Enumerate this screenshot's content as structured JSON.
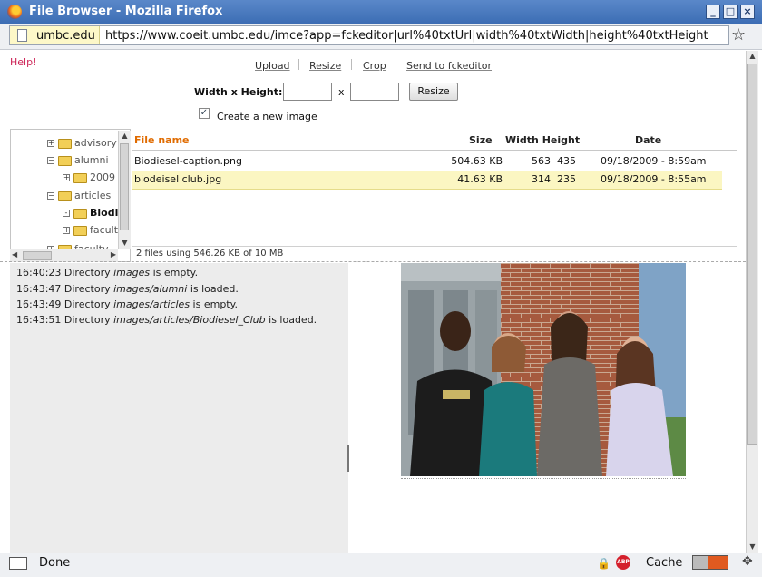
{
  "window": {
    "title": "File Browser - Mozilla Firefox"
  },
  "urlbar": {
    "site": "umbc.edu",
    "url": "https://www.coeit.umbc.edu/imce?app=fckeditor|url%40txtUrl|width%40txtWidth|height%40txtHeight"
  },
  "help_label": "Help!",
  "ops": [
    "Upload",
    "Resize",
    "Crop",
    "Send to fckeditor"
  ],
  "resize_form": {
    "label": "Width x Height:",
    "x": "x",
    "button": "Resize",
    "checkbox_label": "Create a new image",
    "checked": true
  },
  "tree": [
    {
      "label": "advisory",
      "toggle": "+"
    },
    {
      "label": "alumni",
      "toggle": "−"
    },
    {
      "label": "2009",
      "toggle": "+"
    },
    {
      "label": "articles",
      "toggle": "−"
    },
    {
      "label": "Biodiesel_Club",
      "toggle": "-"
    },
    {
      "label": "faculty",
      "toggle": "+"
    },
    {
      "label": "faculty",
      "toggle": "+"
    }
  ],
  "files": {
    "headers": {
      "name": "File name",
      "size": "Size",
      "dims": "Width Height",
      "date": "Date"
    },
    "rows": [
      {
        "name": "Biodiesel-caption.png",
        "size": "504.63 KB",
        "width": "563",
        "height": "435",
        "date": "09/18/2009 - 8:59am"
      },
      {
        "name": "biodeisel club.jpg",
        "size": "41.63 KB",
        "width": "314",
        "height": "235",
        "date": "09/18/2009 - 8:55am"
      }
    ],
    "summary": "2 files using 546.26 KB of 10 MB"
  },
  "log": [
    {
      "time": "16:40:23",
      "pre": "Directory",
      "dir": "images",
      "post": "is empty."
    },
    {
      "time": "16:43:47",
      "pre": "Directory",
      "dir": "images/alumni",
      "post": "is loaded."
    },
    {
      "time": "16:43:49",
      "pre": "Directory",
      "dir": "images/articles",
      "post": "is empty."
    },
    {
      "time": "16:43:51",
      "pre": "Directory",
      "dir": "images/articles/Biodiesel_Club",
      "post": "is loaded."
    }
  ],
  "statusbar": {
    "text": "Done",
    "cache": "Cache",
    "adblock": "ABP"
  },
  "colors": {
    "accent_orange": "#e06b00",
    "selected_row": "#fbf6c2",
    "titlebar": "#4a7bc0"
  }
}
